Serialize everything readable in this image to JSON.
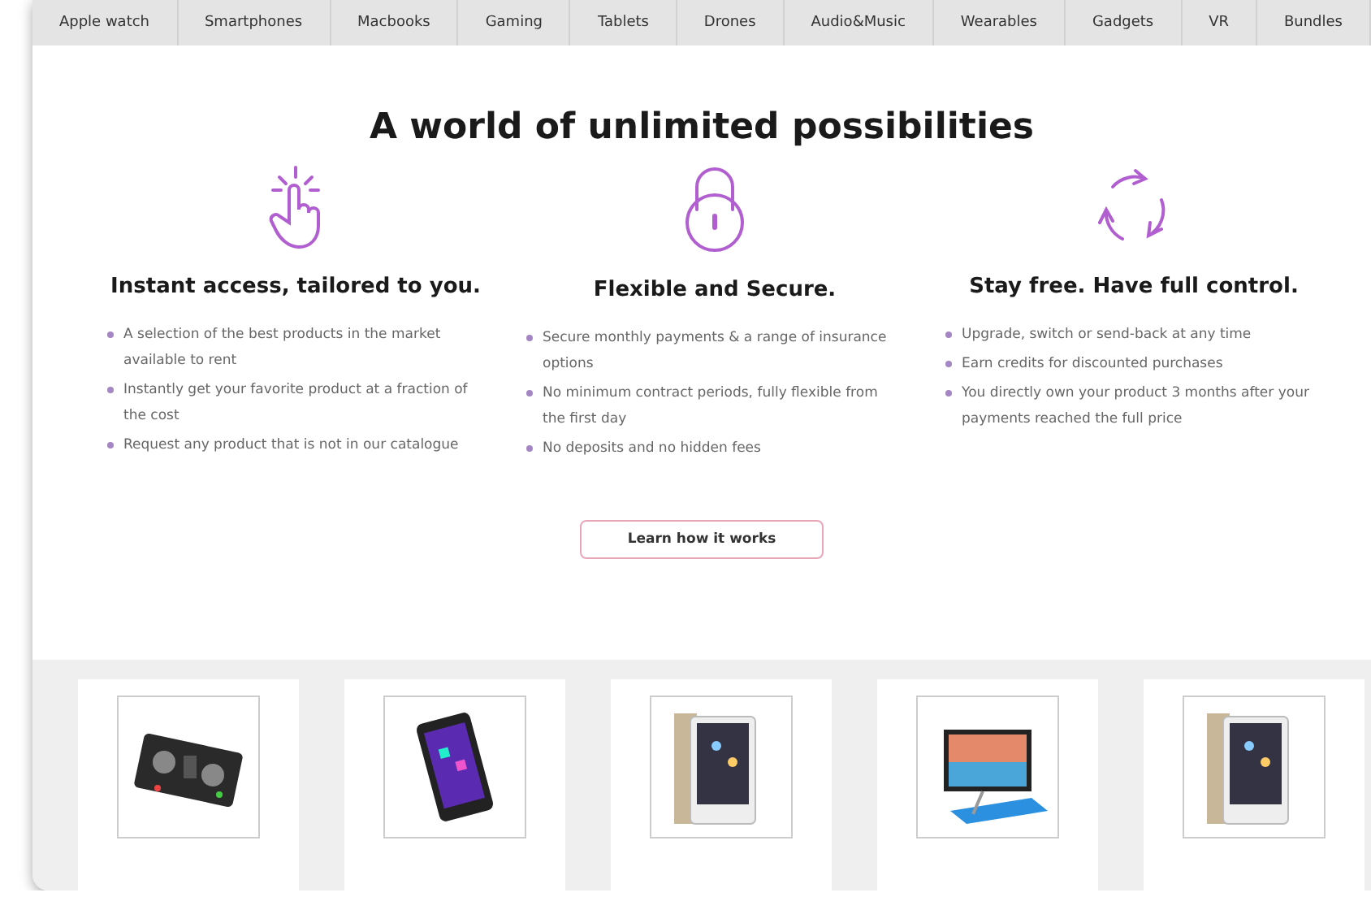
{
  "nav": {
    "tabs": [
      {
        "label": "Apple watch",
        "selected": false
      },
      {
        "label": "Smartphones",
        "selected": false
      },
      {
        "label": "Macbooks",
        "selected": false
      },
      {
        "label": "Gaming",
        "selected": false
      },
      {
        "label": "Tablets",
        "selected": false
      },
      {
        "label": "Drones",
        "selected": false
      },
      {
        "label": "Audio&Music",
        "selected": false
      },
      {
        "label": "Wearables",
        "selected": false
      },
      {
        "label": "Gadgets",
        "selected": false
      },
      {
        "label": "VR",
        "selected": false
      },
      {
        "label": "Bundles",
        "selected": false
      }
    ]
  },
  "hero": {
    "title": "A world of unlimited possibilities"
  },
  "features": [
    {
      "heading": "Instant access, tailored to you.",
      "bullets": [
        "A selection of the best products in the market available to rent",
        "Instantly get your favorite product at a fraction of the cost",
        "Request any product that is not in our catalogue"
      ]
    },
    {
      "heading": "Flexible and Secure.",
      "bullets": [
        "Secure monthly payments & a range of insurance options",
        "No minimum contract periods, fully flexible from the first day",
        "No deposits and no hidden fees"
      ]
    },
    {
      "heading": "Stay free. Have full control.",
      "bullets": [
        "Upgrade, switch or send-back at any time",
        "Earn credits for discounted purchases",
        "You directly own your product 3 months after your payments reached the full price"
      ]
    }
  ],
  "cta": {
    "label": "Learn how it works"
  }
}
